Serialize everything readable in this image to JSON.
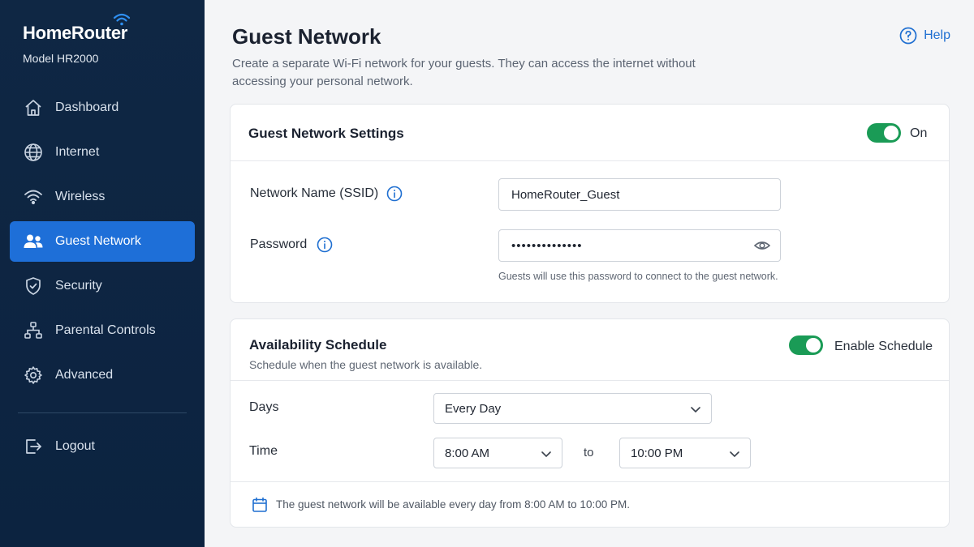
{
  "brand": {
    "name": "HomeRouter",
    "model": "Model HR2000"
  },
  "sidebar": {
    "items": [
      {
        "label": "Dashboard",
        "icon": "home-icon",
        "active": false
      },
      {
        "label": "Internet",
        "icon": "globe-icon",
        "active": false
      },
      {
        "label": "Wireless",
        "icon": "wifi-icon",
        "active": false
      },
      {
        "label": "Guest Network",
        "icon": "users-icon",
        "active": true
      },
      {
        "label": "Security",
        "icon": "shield-icon",
        "active": false
      },
      {
        "label": "Parental Controls",
        "icon": "hierarchy-icon",
        "active": false
      },
      {
        "label": "Advanced",
        "icon": "gear-icon",
        "active": false
      }
    ],
    "logout": {
      "label": "Logout",
      "icon": "logout-icon"
    }
  },
  "header": {
    "title": "Guest Network",
    "description": "Create a separate Wi-Fi network for your guests. They can access the internet without accessing your personal network.",
    "help_label": "Help"
  },
  "settings": {
    "title": "Guest Network Settings",
    "toggle_on": true,
    "toggle_label": "On",
    "ssid_label": "Network Name (SSID)",
    "ssid_value": "HomeRouter_Guest",
    "password_label": "Password",
    "password_value": "••••••••••••••",
    "password_hint": "Guests will use this password to connect to the guest network."
  },
  "schedule": {
    "title": "Availability Schedule",
    "subtitle": "Schedule when the guest network is available.",
    "toggle_on": true,
    "toggle_label": "Enable Schedule",
    "days_label": "Days",
    "days_value": "Every Day",
    "time_label": "Time",
    "start_time": "8:00 AM",
    "to_label": "to",
    "end_time": "10:00 PM",
    "summary": "The guest network will be available every day from 8:00 AM to 10:00 PM."
  },
  "colors": {
    "sidebar_bg": "#0f2744",
    "active_nav": "#1e6fd8",
    "toggle_on": "#1a9b56",
    "link_blue": "#1f6fd1"
  }
}
